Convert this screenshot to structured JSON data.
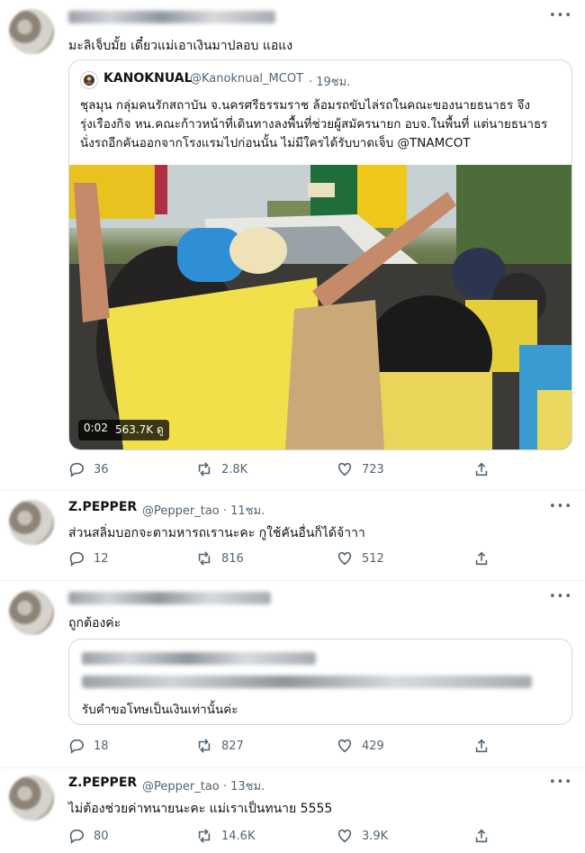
{
  "tweets": [
    {
      "text": "มะลิเจ็บมั้ย เดี๋ยวแม่เอาเงินมาปลอบ แอแง",
      "quote": {
        "name": "KANOKNUAL",
        "handle": "@Kanoknual_MCOT",
        "time": "· 19ชม.",
        "text": "ชุลมุน กลุ่มคนรักสถาบัน จ.นครศรีธรรมราช ล้อมรถขับไล่รถในคณะของนายธนาธร จึงรุ่งเรืองกิจ หน.คณะก้าวหน้าที่เดินทางลงพื้นที่ช่วยผู้สมัครนายก อบจ.ในพื้นที่ แต่นายธนาธร นั่งรถอีกคันออกจากโรงแรมไปก่อนนั้น  ไม่มีใครได้รับบาดเจ็บ @TNAMCOT",
        "video_time": "0:02",
        "video_views": "563.7K ดู"
      },
      "replies": "36",
      "retweets": "2.8K",
      "likes": "723"
    },
    {
      "name": "Z.PEPPER",
      "handle": "@Pepper_tao · 11ชม.",
      "text": "ส่วนสลิ่มบอกจะตามหารถเรานะคะ กูใช้คันอื่นก็ได้จ้าาา",
      "replies": "12",
      "retweets": "816",
      "likes": "512"
    },
    {
      "text": "ถูกต้องค่ะ",
      "quote_text": "รับคำขอโทษเป็นเงินเท่านั้นค่ะ",
      "replies": "18",
      "retweets": "827",
      "likes": "429"
    },
    {
      "name": "Z.PEPPER",
      "handle": "@Pepper_tao · 13ชม.",
      "text": "ไม่ต้องช่วยค่าทนายนะคะ แม่เราเป็นทนาย 5555",
      "replies": "80",
      "retweets": "14.6K",
      "likes": "3.9K"
    }
  ],
  "icons": {
    "reply": "reply-icon",
    "retweet": "retweet-icon",
    "like": "like-icon",
    "share": "share-icon",
    "more": "more-icon"
  },
  "colors": {
    "text": "#0f1419",
    "muted": "#536471",
    "border": "#cfd9de"
  }
}
